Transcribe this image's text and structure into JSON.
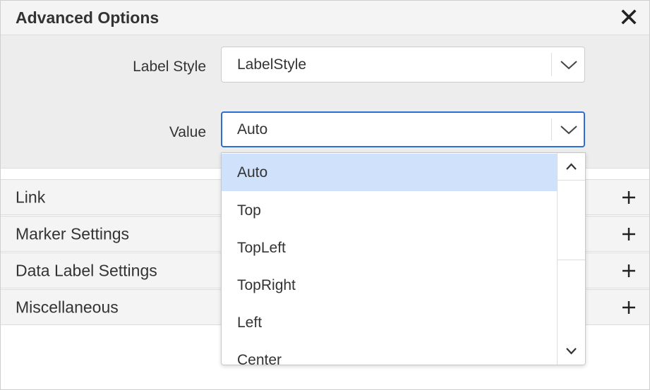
{
  "dialog": {
    "title": "Advanced Options"
  },
  "properties": {
    "label_style": {
      "label": "Label Style",
      "value": "LabelStyle"
    },
    "value": {
      "label": "Value",
      "value": "Auto"
    }
  },
  "sections": [
    {
      "label": "Link"
    },
    {
      "label": "Marker Settings"
    },
    {
      "label": "Data Label Settings"
    },
    {
      "label": "Miscellaneous"
    }
  ],
  "value_dropdown": {
    "options": [
      "Auto",
      "Top",
      "TopLeft",
      "TopRight",
      "Left",
      "Center"
    ],
    "selected": "Auto"
  },
  "colors": {
    "accent": "#2a6fd6",
    "selected_option": "#cfe1fb",
    "header_bg": "#f4f4f4",
    "panel_bg": "#ededed"
  },
  "icons": {
    "close": "close-icon",
    "chevron": "chevron-down-icon",
    "expand": "plus-icon",
    "scroll_up": "chevron-up-icon",
    "scroll_down": "chevron-down-icon"
  }
}
